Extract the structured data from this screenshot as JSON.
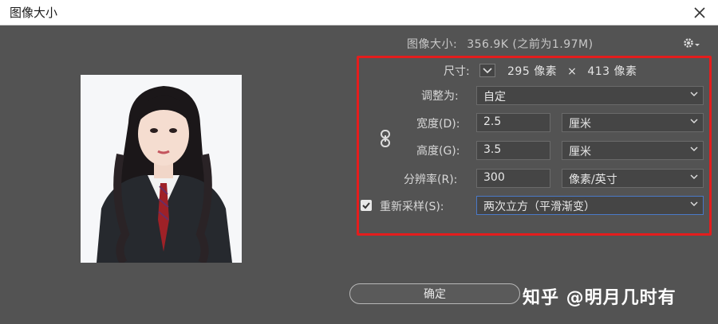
{
  "window": {
    "title": "图像大小"
  },
  "info": {
    "label": "图像大小:",
    "value": "356.9K (之前为1.97M)"
  },
  "dimensions": {
    "label": "尺寸:",
    "width": "295",
    "unit_w": "像素",
    "times": "×",
    "height": "413",
    "unit_h": "像素"
  },
  "fit_to": {
    "label": "调整为:",
    "value": "自定"
  },
  "width": {
    "label": "宽度(D):",
    "value": "2.5",
    "unit": "厘米"
  },
  "height": {
    "label": "高度(G):",
    "value": "3.5",
    "unit": "厘米"
  },
  "resolution": {
    "label": "分辨率(R):",
    "value": "300",
    "unit": "像素/英寸"
  },
  "resample": {
    "label": "重新采样(S):",
    "checked": true,
    "value": "两次立方（平滑渐变）"
  },
  "buttons": {
    "ok": "确定"
  },
  "watermark": "知乎 @明月几时有",
  "colors": {
    "highlight": "#e41d1d",
    "accent": "#4a79c7",
    "background": "#535353"
  },
  "icons": {
    "close": "close-icon",
    "gear": "gear-icon",
    "link": "link-icon",
    "chevron": "chevron-down-icon",
    "check": "check-icon"
  }
}
